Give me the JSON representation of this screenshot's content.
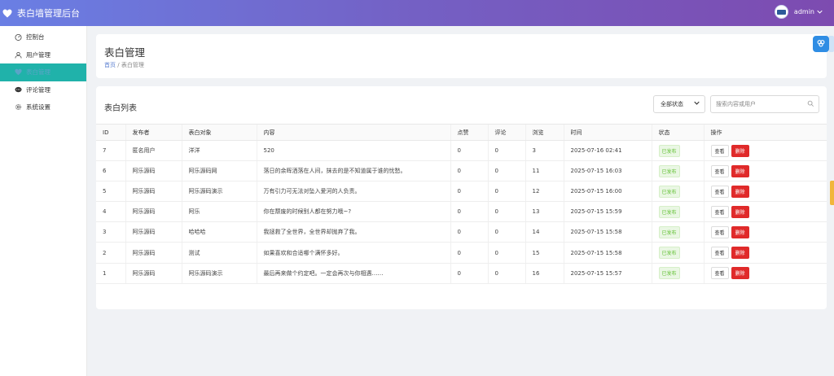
{
  "app": {
    "title": "表白墙管理后台",
    "username": "admin"
  },
  "sidebar": {
    "items": [
      {
        "label": "控制台",
        "icon": "dashboard-icon"
      },
      {
        "label": "用户管理",
        "icon": "user-icon"
      },
      {
        "label": "表白管理",
        "icon": "heart-icon",
        "active": true
      },
      {
        "label": "评论管理",
        "icon": "comment-icon"
      },
      {
        "label": "系统设置",
        "icon": "gear-icon"
      }
    ]
  },
  "page": {
    "title": "表白管理",
    "breadcrumb_home": "首页",
    "breadcrumb_sep": "/",
    "breadcrumb_current": "表白管理"
  },
  "list": {
    "title": "表白列表",
    "status_filter": "全部状态",
    "search_placeholder": "搜索内容或用户",
    "columns": [
      "ID",
      "发布者",
      "表白对象",
      "内容",
      "点赞",
      "评论",
      "浏览",
      "时间",
      "状态",
      "操作"
    ],
    "rows": [
      {
        "id": "7",
        "publisher": "匿名用户",
        "target": "洋洋",
        "content": "520",
        "likes": "0",
        "comments": "0",
        "views": "3",
        "time": "2025-07-16 02:41",
        "status": "已发布"
      },
      {
        "id": "6",
        "publisher": "阿乐源码",
        "target": "阿乐源码网",
        "content": "落日的余晖洒落在人间，抹去的是不知道属于谁的忧愁。",
        "likes": "0",
        "comments": "0",
        "views": "11",
        "time": "2025-07-15 16:03",
        "status": "已发布"
      },
      {
        "id": "5",
        "publisher": "阿乐源码",
        "target": "阿乐源码演示",
        "content": "万有引力可无法对坠入爱河的人负责。",
        "likes": "0",
        "comments": "0",
        "views": "12",
        "time": "2025-07-15 16:00",
        "status": "已发布"
      },
      {
        "id": "4",
        "publisher": "阿乐源码",
        "target": "阿乐",
        "content": "你在颓废的时候别人都在努力哦~?",
        "likes": "0",
        "comments": "0",
        "views": "13",
        "time": "2025-07-15 15:59",
        "status": "已发布"
      },
      {
        "id": "3",
        "publisher": "阿乐源码",
        "target": "哈哈哈",
        "content": "我拯救了全世界，全世界却抛弃了我。",
        "likes": "0",
        "comments": "0",
        "views": "14",
        "time": "2025-07-15 15:58",
        "status": "已发布"
      },
      {
        "id": "2",
        "publisher": "阿乐源码",
        "target": "测试",
        "content": "如果喜欢和合适哪个满怀多好。",
        "likes": "0",
        "comments": "0",
        "views": "15",
        "time": "2025-07-15 15:58",
        "status": "已发布"
      },
      {
        "id": "1",
        "publisher": "阿乐源码",
        "target": "阿乐源码演示",
        "content": "最后再来做个约定吧。一定会再次与你相遇……",
        "likes": "0",
        "comments": "0",
        "views": "16",
        "time": "2025-07-15 15:57",
        "status": "已发布"
      }
    ],
    "action_view": "查看",
    "action_delete": "删除"
  },
  "colors": {
    "topbar_start": "#6a7fe4",
    "topbar_end": "#7d4bb0",
    "active_nav": "#20b2aa",
    "delete": "#e02a2a",
    "status_ok": "#67c23a"
  }
}
